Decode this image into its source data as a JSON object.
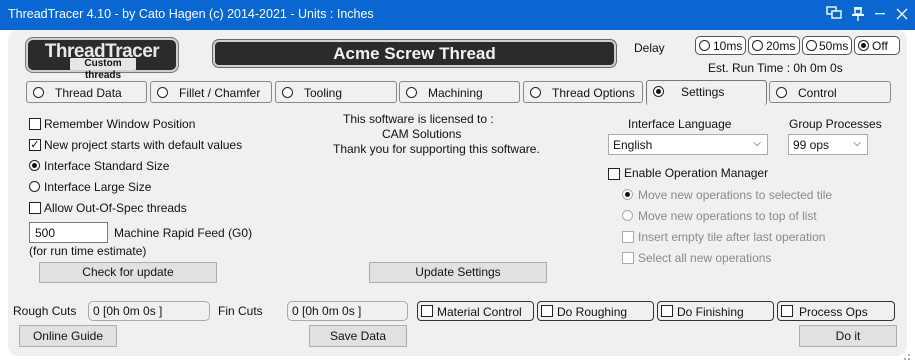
{
  "window": {
    "title": "ThreadTracer 4.10 - by Cato Hagen (c) 2014-2021 - Units : Inches"
  },
  "logo": {
    "line1": "ThreadTracer",
    "line2": "Custom threads"
  },
  "banner": {
    "text": "Acme Screw Thread"
  },
  "delay": {
    "label": "Delay",
    "options": [
      "10ms",
      "20ms",
      "50ms",
      "Off"
    ],
    "selected": "Off",
    "est_run_time": "Est. Run Time : 0h 0m 0s"
  },
  "tabs": [
    {
      "label": "Thread Data",
      "active": false
    },
    {
      "label": "Fillet / Chamfer",
      "active": false
    },
    {
      "label": "Tooling",
      "active": false
    },
    {
      "label": "Machining",
      "active": false
    },
    {
      "label": "Thread Options",
      "active": false
    },
    {
      "label": "Settings",
      "active": true
    },
    {
      "label": "Control",
      "active": false
    }
  ],
  "settings": {
    "remember_window": {
      "label": "Remember Window Position",
      "checked": false
    },
    "new_project_defaults": {
      "label": "New project starts with default values",
      "checked": true
    },
    "interface_standard": {
      "label": "Interface Standard Size",
      "selected": true
    },
    "interface_large": {
      "label": "Interface Large Size",
      "selected": false
    },
    "allow_out_of_spec": {
      "label": "Allow Out-Of-Spec threads",
      "checked": false
    },
    "rapid_feed": {
      "value": "500",
      "label": "Machine Rapid Feed (G0)",
      "note": "(for run time estimate)"
    },
    "check_update": "Check for update",
    "license": {
      "line1": "This software is licensed to :",
      "line2": "CAM Solutions",
      "line3": "Thank you for supporting this software."
    },
    "update_settings": "Update Settings",
    "interface_language": {
      "label": "Interface Language",
      "value": "English"
    },
    "group_processes": {
      "label": "Group Processes",
      "value": "99 ops"
    },
    "enable_op_manager": {
      "label": "Enable Operation Manager",
      "checked": false
    },
    "move_selected": "Move new operations to selected tile",
    "move_top": "Move new operations to top of list",
    "insert_empty": "Insert empty tile after last operation",
    "select_all": "Select all new operations"
  },
  "bottom": {
    "rough_cuts_label": "Rough Cuts",
    "rough_cuts_value": "0 [0h 0m 0s ]",
    "fin_cuts_label": "Fin Cuts",
    "fin_cuts_value": "0 [0h 0m 0s ]",
    "material_control": "Material Control",
    "do_roughing": "Do Roughing",
    "do_finishing": "Do Finishing",
    "process_ops": "Process Ops",
    "online_guide": "Online Guide",
    "save_data": "Save Data",
    "do_it": "Do it"
  }
}
